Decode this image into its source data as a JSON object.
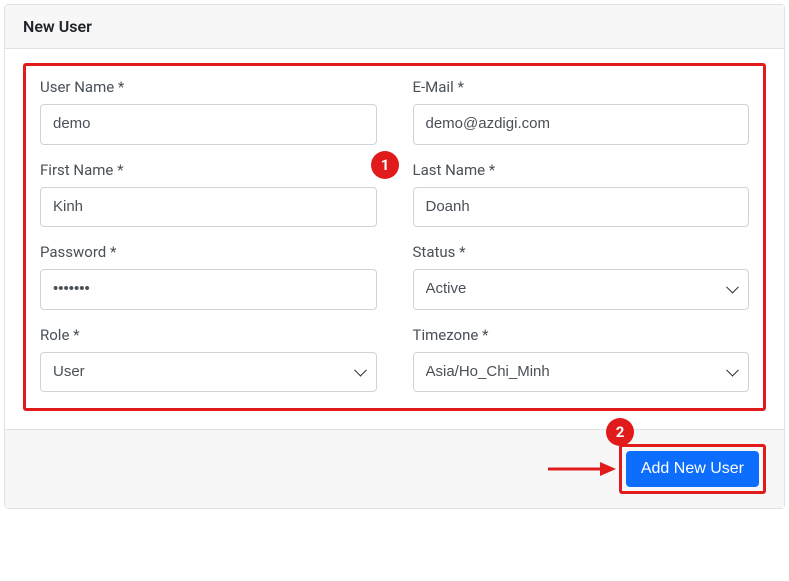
{
  "header": {
    "title": "New User"
  },
  "annotations": {
    "badge1": "1",
    "badge2": "2"
  },
  "form": {
    "username": {
      "label": "User Name *",
      "value": "demo"
    },
    "email": {
      "label": "E-Mail *",
      "value": "demo@azdigi.com"
    },
    "firstname": {
      "label": "First Name *",
      "value": "Kinh"
    },
    "lastname": {
      "label": "Last Name *",
      "value": "Doanh"
    },
    "password": {
      "label": "Password *",
      "value": "•••••••"
    },
    "status": {
      "label": "Status *",
      "value": "Active"
    },
    "role": {
      "label": "Role *",
      "value": "User"
    },
    "timezone": {
      "label": "Timezone *",
      "value": "Asia/Ho_Chi_Minh"
    }
  },
  "footer": {
    "submit_label": "Add New User"
  },
  "colors": {
    "annotation": "#e11b1b",
    "primary": "#0d6efd"
  }
}
